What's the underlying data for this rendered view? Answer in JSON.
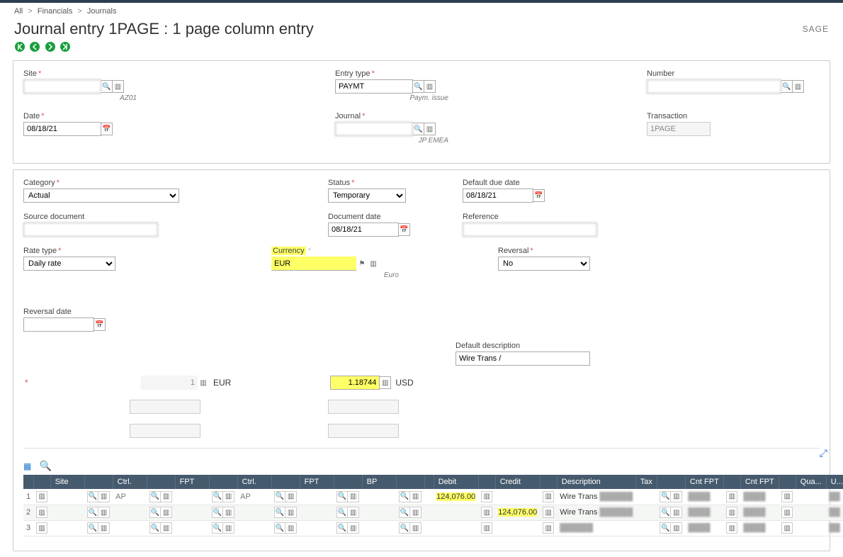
{
  "breadcrumb": {
    "all": "All",
    "financials": "Financials",
    "journals": "Journals"
  },
  "page_title": "Journal entry 1PAGE : 1 page column entry",
  "brand": "SAGE",
  "fields": {
    "site_label": "Site",
    "site_value": "",
    "site_sub": "AZ01",
    "entry_type_label": "Entry type",
    "entry_type_value": "PAYMT",
    "entry_type_sub": "Paym. issue",
    "number_label": "Number",
    "number_value": "",
    "date_label": "Date",
    "date_value": "08/18/21",
    "journal_label": "Journal",
    "journal_value": "",
    "journal_sub": "JP EMEA",
    "transaction_label": "Transaction",
    "transaction_value": "1PAGE",
    "category_label": "Category",
    "category_value": "Actual",
    "status_label": "Status",
    "status_value": "Temporary",
    "default_due_label": "Default due date",
    "default_due_value": "08/18/21",
    "source_doc_label": "Source document",
    "source_doc_value": "",
    "doc_date_label": "Document date",
    "doc_date_value": "08/18/21",
    "reference_label": "Reference",
    "reference_value": "",
    "rate_type_label": "Rate type",
    "rate_type_value": "Daily rate",
    "currency_label": "Currency",
    "currency_value": "EUR",
    "currency_sub": "Euro",
    "reversal_label": "Reversal",
    "reversal_value": "No",
    "reversal_date_label": "Reversal date",
    "reversal_date_value": "",
    "default_desc_label": "Default description",
    "default_desc_value": "Wire Trans / ",
    "rate_one": "1",
    "rate_one_unit": "EUR",
    "rate_val": "1.18744",
    "rate_val_unit": "USD"
  },
  "grid": {
    "cols": [
      "",
      "",
      "Site",
      "",
      "Ctrl.",
      "",
      "FPT",
      "",
      "Ctrl.",
      "",
      "FPT",
      "",
      "BP",
      "",
      "",
      "Debit",
      "",
      "Credit",
      "",
      "Description",
      "Tax",
      "",
      "Cnt FPT",
      "",
      "Cnt FPT",
      "",
      "Qua...",
      "U..."
    ],
    "rows": [
      {
        "n": "1",
        "site": "",
        "ctrl1": "AP",
        "fpt1": "",
        "ctrl2": "AP",
        "fpt2": "",
        "bp": "",
        "debit": "124,076.00",
        "credit": "",
        "desc": "Wire Trans",
        "cnt1": "",
        "cnt2": ""
      },
      {
        "n": "2",
        "site": "",
        "ctrl1": "",
        "fpt1": "",
        "ctrl2": "",
        "fpt2": "",
        "bp": "",
        "debit": "",
        "credit": "124,076.00",
        "desc": "Wire Trans",
        "cnt1": "",
        "cnt2": ""
      },
      {
        "n": "3",
        "site": "",
        "ctrl1": "",
        "fpt1": "",
        "ctrl2": "",
        "fpt2": "",
        "bp": "",
        "debit": "",
        "credit": "",
        "desc": "",
        "cnt1": "",
        "cnt2": ""
      }
    ]
  }
}
